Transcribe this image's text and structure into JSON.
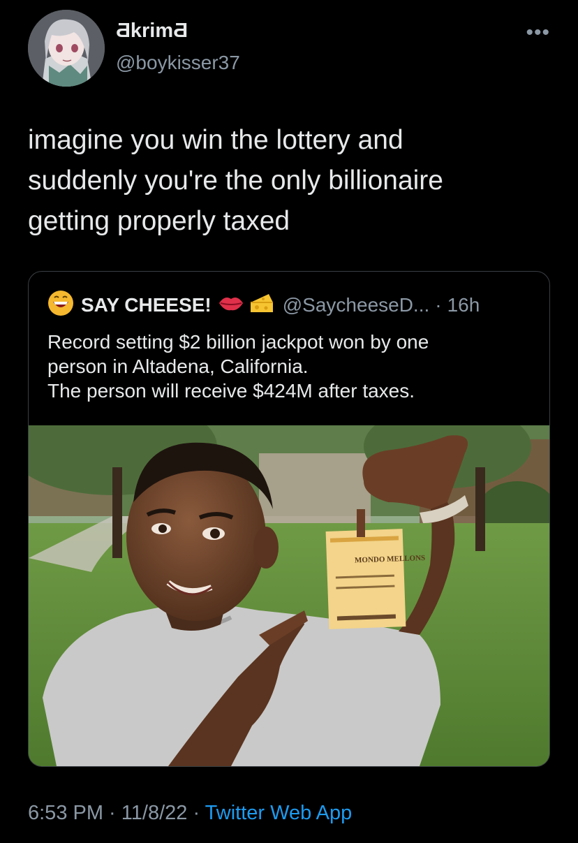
{
  "author": {
    "display_name": "ƋkrimƋ",
    "handle": "@boykisser37",
    "avatar_icon": "anime-avatar-icon"
  },
  "more_icon": "more-options-icon",
  "tweet": {
    "text": "imagine you win the lottery and\nsuddenly you're the only billionaire\ngetting properly taxed"
  },
  "quoted": {
    "name": "SAY CHEESE!",
    "handle": "@SaycheeseD...",
    "separator": "·",
    "time": "16h",
    "text": "Record setting $2 billion jackpot won by one\nperson in Altadena, California.\nThe person will receive $424M after taxes.",
    "icons": [
      "laughing-face-icon",
      "lips-icon",
      "cheese-icon"
    ],
    "image": {
      "ticket_brand": "MONDO MELLONS"
    }
  },
  "footer": {
    "time": "6:53 PM",
    "sep1": " · ",
    "date": "11/8/22",
    "sep2": " · ",
    "source": "Twitter Web App"
  },
  "colors": {
    "background": "#000000",
    "text": "#e7e9ea",
    "secondary": "#8b98a5",
    "link": "#1d9bf0"
  }
}
